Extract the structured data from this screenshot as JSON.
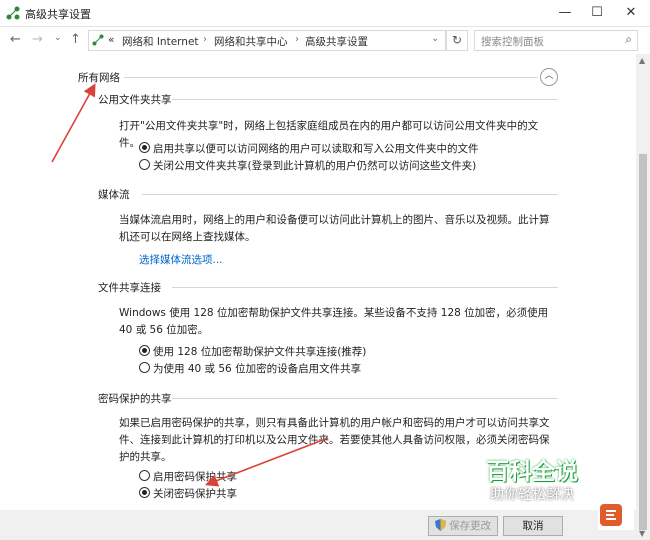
{
  "window": {
    "title": "高级共享设置",
    "min_glyph": "—",
    "max_glyph": "☐",
    "close_glyph": "✕"
  },
  "nav": {
    "back": "←",
    "forward": "→",
    "dropdown": "⌄",
    "up": "↑",
    "breadcrumb": [
      "«",
      "网络和 Internet",
      "网络和共享中心",
      "高级共享设置"
    ],
    "sep": "›",
    "addr_dropdown": "⌄",
    "refresh": "↻",
    "search_placeholder": "搜索控制面板",
    "search_icon": "⌕"
  },
  "group": {
    "title": "所有网络",
    "collapse": "︿"
  },
  "sections": {
    "public": {
      "title": "公用文件夹共享",
      "desc": "打开\"公用文件夹共享\"时，网络上包括家庭组成员在内的用户都可以访问公用文件夹中的文件。",
      "opt1": "启用共享以便可以访问网络的用户可以读取和写入公用文件夹中的文件",
      "opt2": "关闭公用文件夹共享(登录到此计算机的用户仍然可以访问这些文件夹)"
    },
    "media": {
      "title": "媒体流",
      "desc": "当媒体流启用时，网络上的用户和设备便可以访问此计算机上的图片、音乐以及视频。此计算机还可以在网络上查找媒体。",
      "link": "选择媒体流选项..."
    },
    "file": {
      "title": "文件共享连接",
      "desc": "Windows 使用 128 位加密帮助保护文件共享连接。某些设备不支持 128 位加密，必须使用 40 或 56 位加密。",
      "opt1": "使用 128 位加密帮助保护文件共享连接(推荐)",
      "opt2": "为使用 40 或 56 位加密的设备启用文件共享"
    },
    "password": {
      "title": "密码保护的共享",
      "desc": "如果已启用密码保护的共享，则只有具备此计算机的用户帐户和密码的用户才可以访问共享文件、连接到此计算机的打印机以及公用文件夹。若要使其他人具备访问权限，必须关闭密码保护的共享。",
      "opt1": "启用密码保护共享",
      "opt2": "关闭密码保护共享"
    }
  },
  "footer": {
    "save": "保存更改",
    "cancel": "取消"
  },
  "watermark": {
    "big": "百科全说",
    "small": "助你轻松解决"
  },
  "scroll": {
    "up": "▲",
    "down": "▼"
  },
  "colors": {
    "accent": "#0066cc",
    "annotation": "#d9433a",
    "watermark_green": "#1a9e3c"
  }
}
